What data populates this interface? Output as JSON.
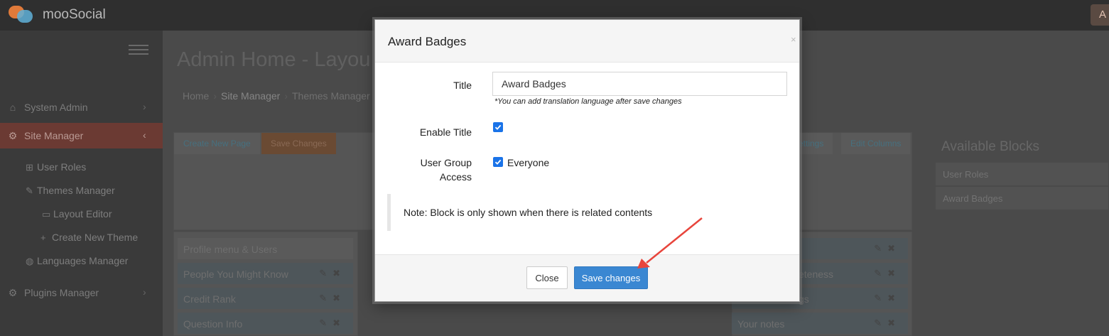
{
  "app": {
    "brand": "mooSocial",
    "user_initial": "A"
  },
  "sidebar": {
    "items": [
      {
        "label": "System Admin",
        "icon": "home-icon"
      },
      {
        "label": "Site Manager",
        "icon": "gears-icon"
      },
      {
        "label": "Plugins Manager",
        "icon": "gear-icon"
      }
    ],
    "sub_items": [
      {
        "label": "User Roles",
        "icon": "plus-square-icon"
      },
      {
        "label": "Themes Manager",
        "icon": "brush-icon"
      },
      {
        "label": "Layout Editor",
        "icon": "window-icon"
      },
      {
        "label": "Create New Theme",
        "icon": "plus-icon"
      },
      {
        "label": "Languages Manager",
        "icon": "globe-icon"
      }
    ]
  },
  "page": {
    "title": "Admin Home - Layou",
    "breadcrumb": [
      "Home",
      "Site Manager",
      "Themes Manager"
    ]
  },
  "toolbar": {
    "create_new_page": "Create New Page",
    "save_changes": "Save Changes",
    "settings": "ettings",
    "edit_columns": "Edit Columns"
  },
  "layout": {
    "left_blocks": [
      "Profile menu & Users",
      "People You Might Know",
      "Credit Rank",
      "Question Info"
    ],
    "right_blocks": [
      "",
      "eteness",
      "gs",
      "Your notes"
    ]
  },
  "available_blocks": {
    "title": "Available Blocks",
    "items": [
      "User Roles",
      "Award Badges"
    ]
  },
  "modal": {
    "title": "Award Badges",
    "close_symbol": "×",
    "fields": {
      "title_label": "Title",
      "title_value": "Award Badges",
      "hint": "*You can add translation language after save changes",
      "enable_title_label": "Enable Title",
      "user_group_label_1": "User Group",
      "user_group_label_2": "Access",
      "everyone_label": "Everyone"
    },
    "note": "Note: Block is only shown when there is related contents",
    "buttons": {
      "close": "Close",
      "save": "Save changes"
    }
  },
  "colors": {
    "primary": "#3a87d2",
    "checkbox": "#1a73e8",
    "annotation_arrow": "#e8453c",
    "overlay": "#4a4a4a"
  }
}
